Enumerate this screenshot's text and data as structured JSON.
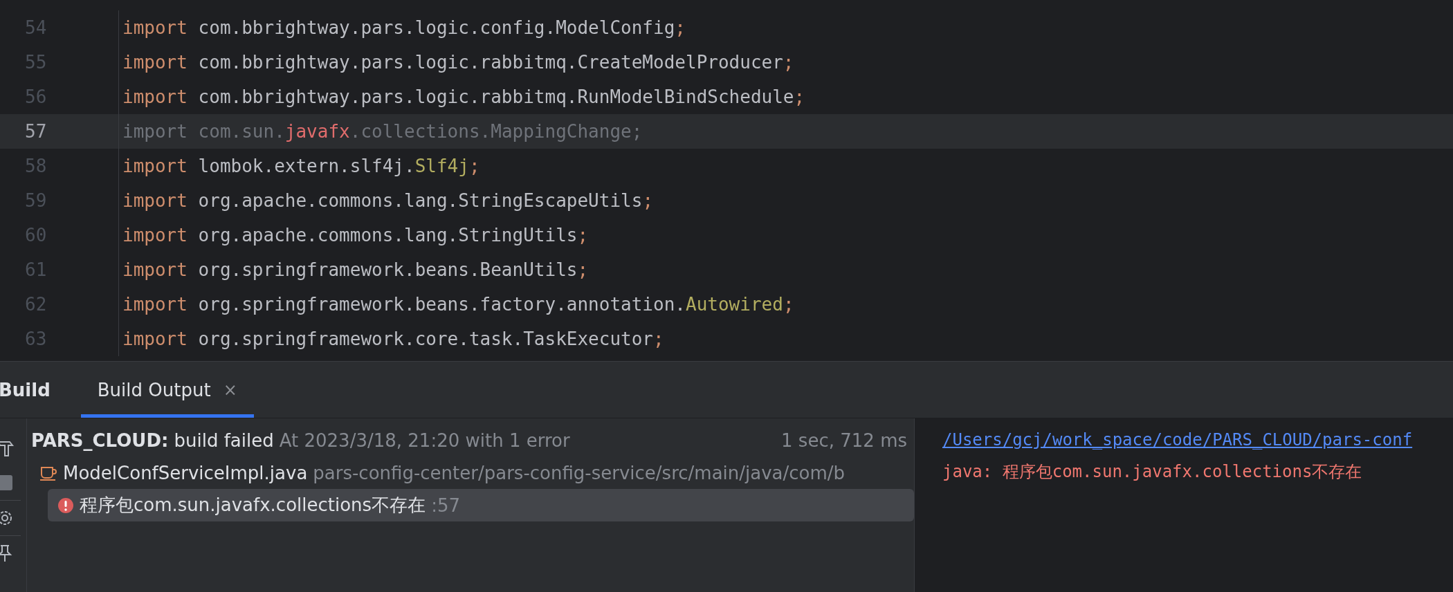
{
  "editor": {
    "lines": [
      {
        "number": "54",
        "current": false,
        "unused": false,
        "tokens": [
          {
            "kind": "keyword",
            "text": "import"
          },
          {
            "kind": "plain",
            "text": " com.bbrightway.pars.logic.config.ModelConfig"
          },
          {
            "kind": "punct",
            "text": ";"
          }
        ]
      },
      {
        "number": "55",
        "current": false,
        "unused": false,
        "tokens": [
          {
            "kind": "keyword",
            "text": "import"
          },
          {
            "kind": "plain",
            "text": " com.bbrightway.pars.logic.rabbitmq.CreateModelProducer"
          },
          {
            "kind": "punct",
            "text": ";"
          }
        ]
      },
      {
        "number": "56",
        "current": false,
        "unused": false,
        "tokens": [
          {
            "kind": "keyword",
            "text": "import"
          },
          {
            "kind": "plain",
            "text": " com.bbrightway.pars.logic.rabbitmq.RunModelBindSchedule"
          },
          {
            "kind": "punct",
            "text": ";"
          }
        ]
      },
      {
        "number": "57",
        "current": true,
        "unused": true,
        "tokens": [
          {
            "kind": "keyword",
            "text": "import"
          },
          {
            "kind": "plain",
            "text": " com.sun."
          },
          {
            "kind": "error",
            "text": "javafx"
          },
          {
            "kind": "plain",
            "text": ".collections.MappingChange"
          },
          {
            "kind": "punct",
            "text": ";"
          }
        ]
      },
      {
        "number": "58",
        "current": false,
        "unused": false,
        "tokens": [
          {
            "kind": "keyword",
            "text": "import"
          },
          {
            "kind": "plain",
            "text": " lombok.extern.slf4j."
          },
          {
            "kind": "annotation",
            "text": "Slf4j"
          },
          {
            "kind": "punct",
            "text": ";"
          }
        ]
      },
      {
        "number": "59",
        "current": false,
        "unused": false,
        "tokens": [
          {
            "kind": "keyword",
            "text": "import"
          },
          {
            "kind": "plain",
            "text": " org.apache.commons.lang.StringEscapeUtils"
          },
          {
            "kind": "punct",
            "text": ";"
          }
        ]
      },
      {
        "number": "60",
        "current": false,
        "unused": false,
        "tokens": [
          {
            "kind": "keyword",
            "text": "import"
          },
          {
            "kind": "plain",
            "text": " org.apache.commons.lang.StringUtils"
          },
          {
            "kind": "punct",
            "text": ";"
          }
        ]
      },
      {
        "number": "61",
        "current": false,
        "unused": false,
        "tokens": [
          {
            "kind": "keyword",
            "text": "import"
          },
          {
            "kind": "plain",
            "text": " org.springframework.beans.BeanUtils"
          },
          {
            "kind": "punct",
            "text": ";"
          }
        ]
      },
      {
        "number": "62",
        "current": false,
        "unused": false,
        "tokens": [
          {
            "kind": "keyword",
            "text": "import"
          },
          {
            "kind": "plain",
            "text": " org.springframework.beans.factory.annotation."
          },
          {
            "kind": "annotation",
            "text": "Autowired"
          },
          {
            "kind": "punct",
            "text": ";"
          }
        ]
      },
      {
        "number": "63",
        "current": false,
        "unused": false,
        "tokens": [
          {
            "kind": "keyword",
            "text": "import"
          },
          {
            "kind": "plain",
            "text": " org.springframework.core.task.TaskExecutor"
          },
          {
            "kind": "punct",
            "text": ";"
          }
        ]
      }
    ]
  },
  "tool_window": {
    "title": "Build",
    "tabs": [
      {
        "label": "Build Output",
        "selected": true,
        "close": "×"
      }
    ]
  },
  "build_tree": [
    {
      "project": "PARS_CLOUD:",
      "status": "build failed",
      "detail": "At 2023/3/18, 21:20 with 1 error",
      "duration": "1 sec, 712 ms",
      "selected": false,
      "children": [
        {
          "file": "ModelConfServiceImpl.java",
          "path": "pars-config-center/pars-config-service/src/main/java/com/b",
          "selected": false,
          "children": [
            {
              "message": "程序包com.sun.javafx.collections不存在",
              "line": ":57",
              "selected": true
            }
          ]
        }
      ]
    }
  ],
  "console": {
    "link": "/Users/gcj/work_space/code/PARS_CLOUD/pars-conf",
    "error": "java: 程序包com.sun.javafx.collections不存在"
  }
}
